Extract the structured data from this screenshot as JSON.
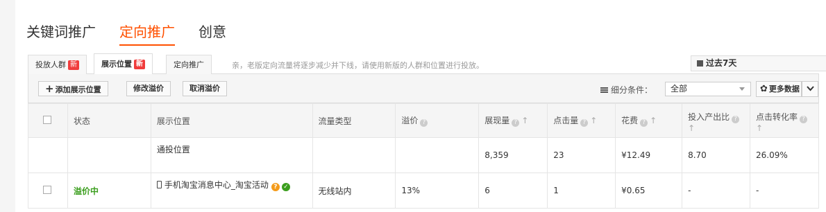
{
  "top_tabs": [
    {
      "label": "关键词推广"
    },
    {
      "label": "定向推广"
    },
    {
      "label": "创意"
    }
  ],
  "sub_tabs": [
    {
      "label": "投放人群",
      "badge": "新"
    },
    {
      "label": "展示位置",
      "badge": "新"
    },
    {
      "label": "定向推广"
    }
  ],
  "notice": "亲，老版定向流量将逐步减少并下线，请使用新版的人群和位置进行投放。",
  "date_range": "过去7天",
  "toolbar": {
    "add_label": "添加展示位置",
    "modify_label": "修改溢价",
    "cancel_label": "取消溢价",
    "segment_label": "细分条件：",
    "segment_value": "全部",
    "more_label": "更多数据"
  },
  "table": {
    "headers": {
      "status": "状态",
      "position": "展示位置",
      "traffic": "流量类型",
      "premium": "溢价",
      "impressions": "展现量",
      "clicks": "点击量",
      "cost": "花费",
      "roi": "投入产出比",
      "cvr": "点击转化率"
    },
    "rows": [
      {
        "status": "",
        "position": "通投位置",
        "traffic": "",
        "premium": "",
        "impressions": "8,359",
        "clicks": "23",
        "cost": "¥12.49",
        "roi": "8.70",
        "cvr": "26.09%"
      },
      {
        "status": "溢价中",
        "position": "手机淘宝消息中心_淘宝活动",
        "traffic": "无线站内",
        "premium": "13%",
        "impressions": "6",
        "clicks": "1",
        "cost": "¥0.65",
        "roi": "-",
        "cvr": "-"
      }
    ]
  },
  "colors": {
    "accent": "#ff5000",
    "badge": "#f03c3c",
    "status_green": "#3b9e1e"
  }
}
